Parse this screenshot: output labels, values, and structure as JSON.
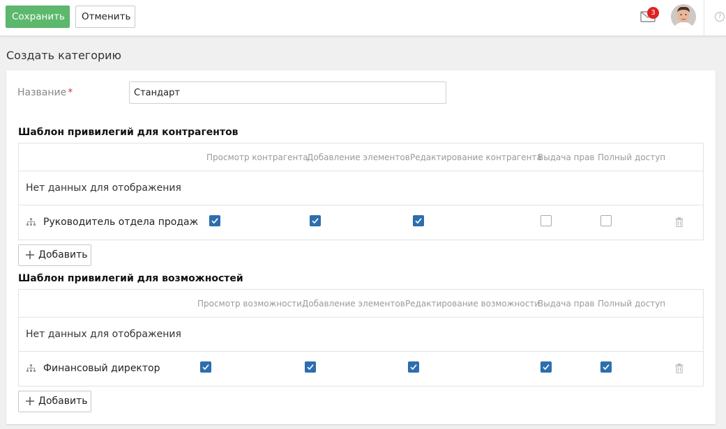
{
  "toolbar": {
    "save_label": "Сохранить",
    "cancel_label": "Отменить",
    "mail_badge_count": "3",
    "help_label": "?"
  },
  "colors": {
    "save_button": "#5cb86d",
    "badge": "#e02222",
    "checkbox_checked": "#2d6fae"
  },
  "page": {
    "title": "Создать категорию"
  },
  "form": {
    "name_label": "Название",
    "required_mark": "*",
    "name_value": "Стандарт"
  },
  "counterparty_section": {
    "title": "Шаблон привилегий для контрагентов",
    "columns": [
      "Просмотр контрагента",
      "Добавление элементов",
      "Редактирование контрагента",
      "Выдача прав",
      "Полный доступ"
    ],
    "empty_text": "Нет данных для отображения",
    "row": {
      "icon": "org-structure-icon",
      "name": "Руководитель отдела продаж",
      "checks": [
        true,
        true,
        true,
        false,
        false
      ]
    },
    "add_label": "Добавить"
  },
  "opportunity_section": {
    "title": "Шаблон привилегий для возможностей",
    "columns": [
      "Просмотр возможности",
      "Добавление элементов",
      "Редактирование возможности",
      "Выдача прав",
      "Полный доступ"
    ],
    "empty_text": "Нет данных для отображения",
    "row": {
      "icon": "org-structure-icon",
      "name": "Финансовый директор",
      "checks": [
        true,
        true,
        true,
        true,
        true
      ]
    },
    "add_label": "Добавить"
  }
}
